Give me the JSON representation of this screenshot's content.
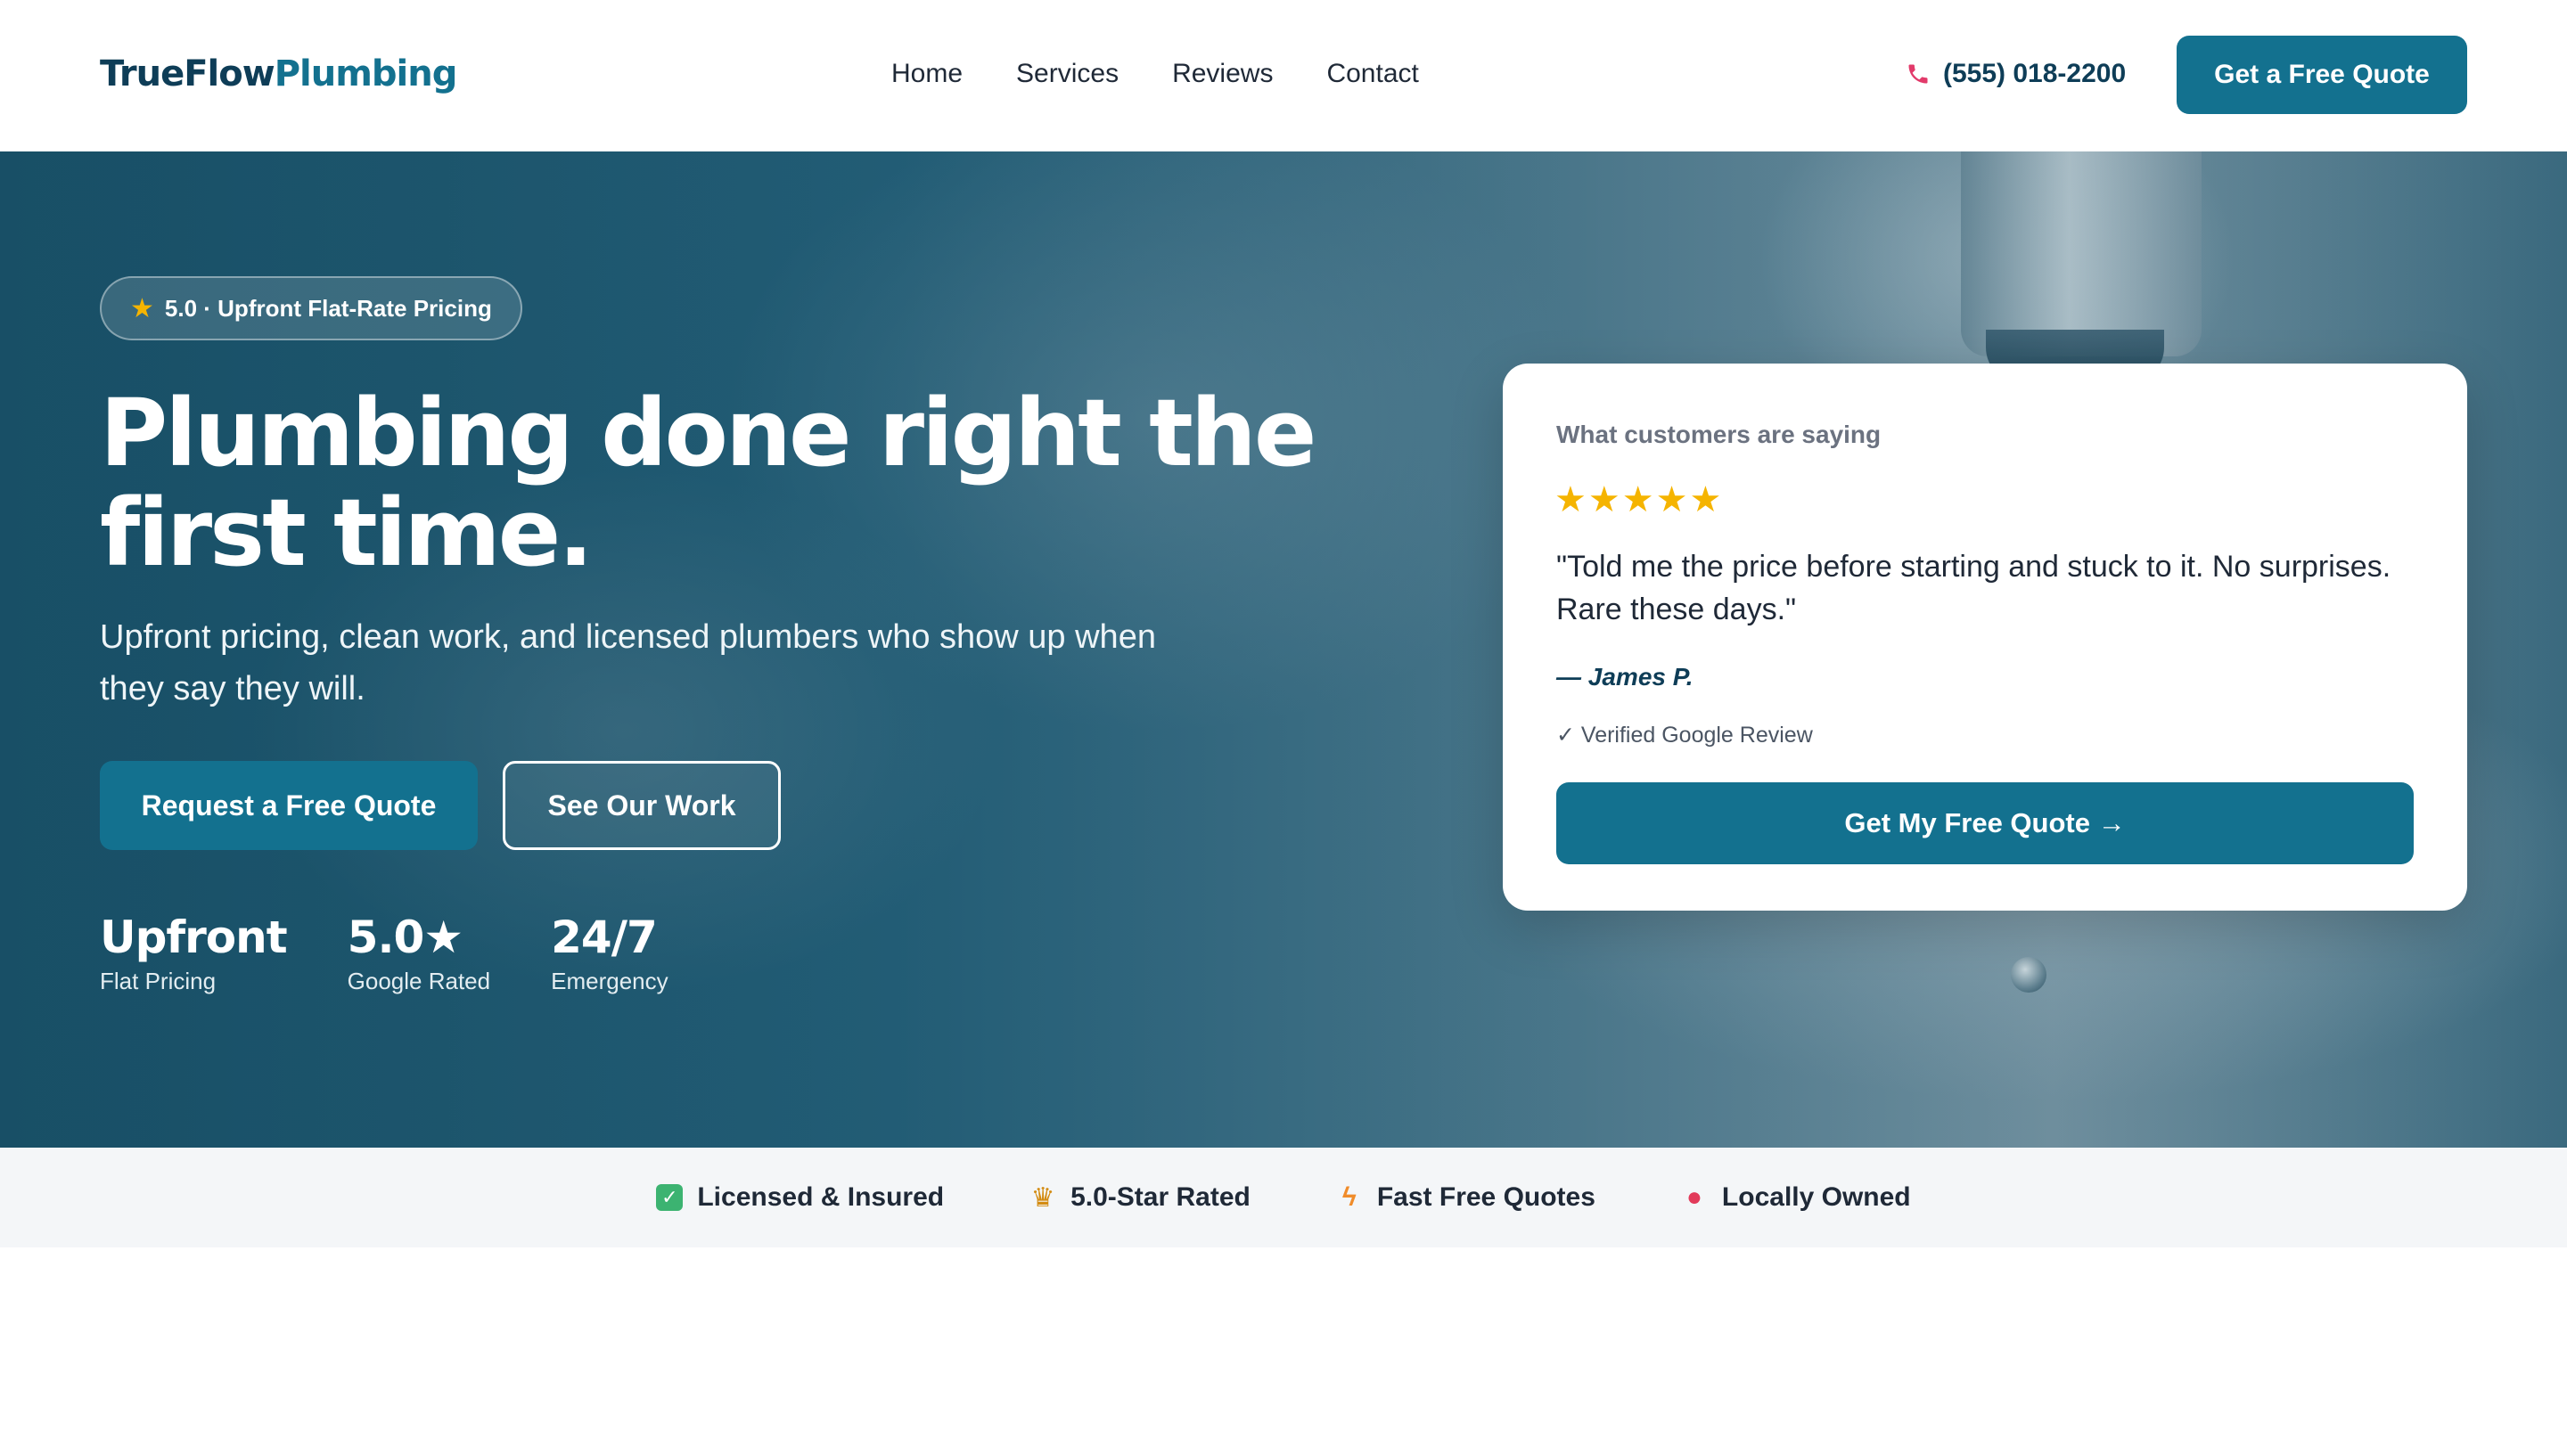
{
  "header": {
    "logo_primary": "TrueFlow",
    "logo_accent": "Plumbing",
    "nav": [
      {
        "label": "Home"
      },
      {
        "label": "Services"
      },
      {
        "label": "Reviews"
      },
      {
        "label": "Contact"
      }
    ],
    "phone": "(555) 018-2200",
    "cta": "Get a Free Quote"
  },
  "hero": {
    "badge": "5.0 · Upfront Flat-Rate Pricing",
    "title": "Plumbing done right the first time.",
    "subtitle": "Upfront pricing, clean work, and licensed plumbers who show up when they say they will.",
    "primary_button": "Request a Free Quote",
    "secondary_button": "See Our Work",
    "stats": [
      {
        "value": "Upfront",
        "label": "Flat Pricing"
      },
      {
        "value": "5.0★",
        "label": "Google Rated"
      },
      {
        "value": "24/7",
        "label": "Emergency"
      }
    ]
  },
  "testimonial": {
    "heading": "What customers are saying",
    "stars": "★★★★★",
    "rating": 5,
    "quote": "\"Told me the price before starting and stuck to it. No surprises. Rare these days.\"",
    "author": "— James P.",
    "verified": "✓ Verified Google Review",
    "button": "Get My Free Quote →"
  },
  "trust": [
    {
      "icon": "check-icon",
      "label": "Licensed & Insured"
    },
    {
      "icon": "trophy-icon",
      "label": "5.0-Star Rated"
    },
    {
      "icon": "bolt-icon",
      "label": "Fast Free Quotes"
    },
    {
      "icon": "pin-icon",
      "label": "Locally Owned"
    }
  ],
  "colors": {
    "brand": "#13718f",
    "brand_dark": "#0e3d57",
    "star": "#f5b400"
  }
}
